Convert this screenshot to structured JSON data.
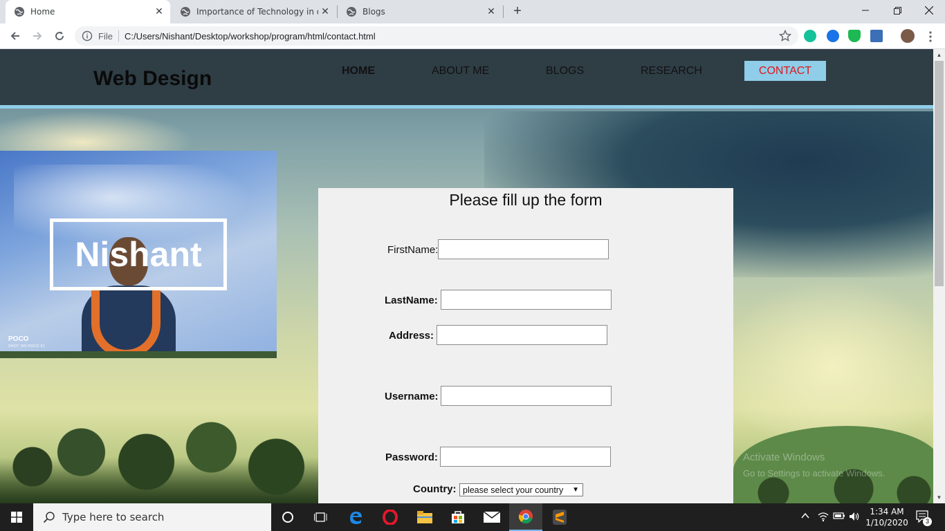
{
  "browser": {
    "tabs": [
      {
        "label": "Home",
        "active": true
      },
      {
        "label": "Importance of Technology in our",
        "active": false
      },
      {
        "label": "Blogs",
        "active": false
      }
    ],
    "address": {
      "scheme_label": "File",
      "url": "C:/Users/Nishant/Desktop/workshop/program/html/contact.html"
    }
  },
  "site": {
    "logo": "Web Design",
    "nav": [
      {
        "label": "HOME"
      },
      {
        "label": "ABOUT ME"
      },
      {
        "label": "BLOGS"
      },
      {
        "label": "RESEARCH"
      },
      {
        "label": "CONTACT"
      }
    ],
    "profile": {
      "name": "Nishant",
      "photo_brand": "POCO",
      "photo_brand_sub": "SHOT ON POCO F1"
    },
    "form": {
      "title": "Please fill up the form",
      "firstname_label": "FirstName:",
      "lastname_label": "LastName:",
      "address_label": "Address:",
      "username_label": "Username:",
      "password_label": "Password:",
      "country_label": "Country:",
      "country_value": "please select your country"
    },
    "watermark": {
      "line1": "Activate Windows",
      "line2": "Go to Settings to activate Windows."
    }
  },
  "taskbar": {
    "search_placeholder": "Type here to search",
    "time": "1:34 AM",
    "date": "1/10/2020",
    "notification_count": "3"
  },
  "colors": {
    "header_bg": "#2f3d45",
    "accent": "#8fcde8",
    "contact_text": "#e0161b",
    "form_bg": "#f0f0f0"
  }
}
